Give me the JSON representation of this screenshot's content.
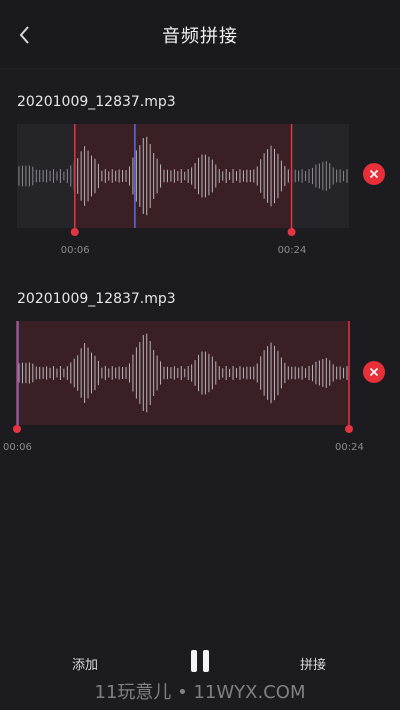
{
  "header": {
    "title": "音频拼接",
    "back_icon": "chevron-left-icon"
  },
  "tracks": [
    {
      "file_name": "20201009_12837.mp3",
      "start_time": "00:06",
      "end_time": "00:24",
      "selection_start": 0.174,
      "selection_end": 0.827,
      "playhead": 0.355,
      "remove_icon": "close-circle-icon"
    },
    {
      "file_name": "20201009_12837.mp3",
      "start_time": "00:06",
      "end_time": "00:24",
      "selection_start": 0.0,
      "selection_end": 1.0,
      "playhead": 0.0,
      "remove_icon": "close-circle-icon"
    }
  ],
  "bottom": {
    "add_label": "添加",
    "merge_label": "拼接",
    "pause_icon": "pause-icon"
  },
  "watermark": "11玩意儿 • 11WYX.COM",
  "colors": {
    "selection_fill": "#3a1f25",
    "handle_red": "#e33542",
    "playhead_blue": "#5b6fd6",
    "waveform": "#8c8a90"
  }
}
